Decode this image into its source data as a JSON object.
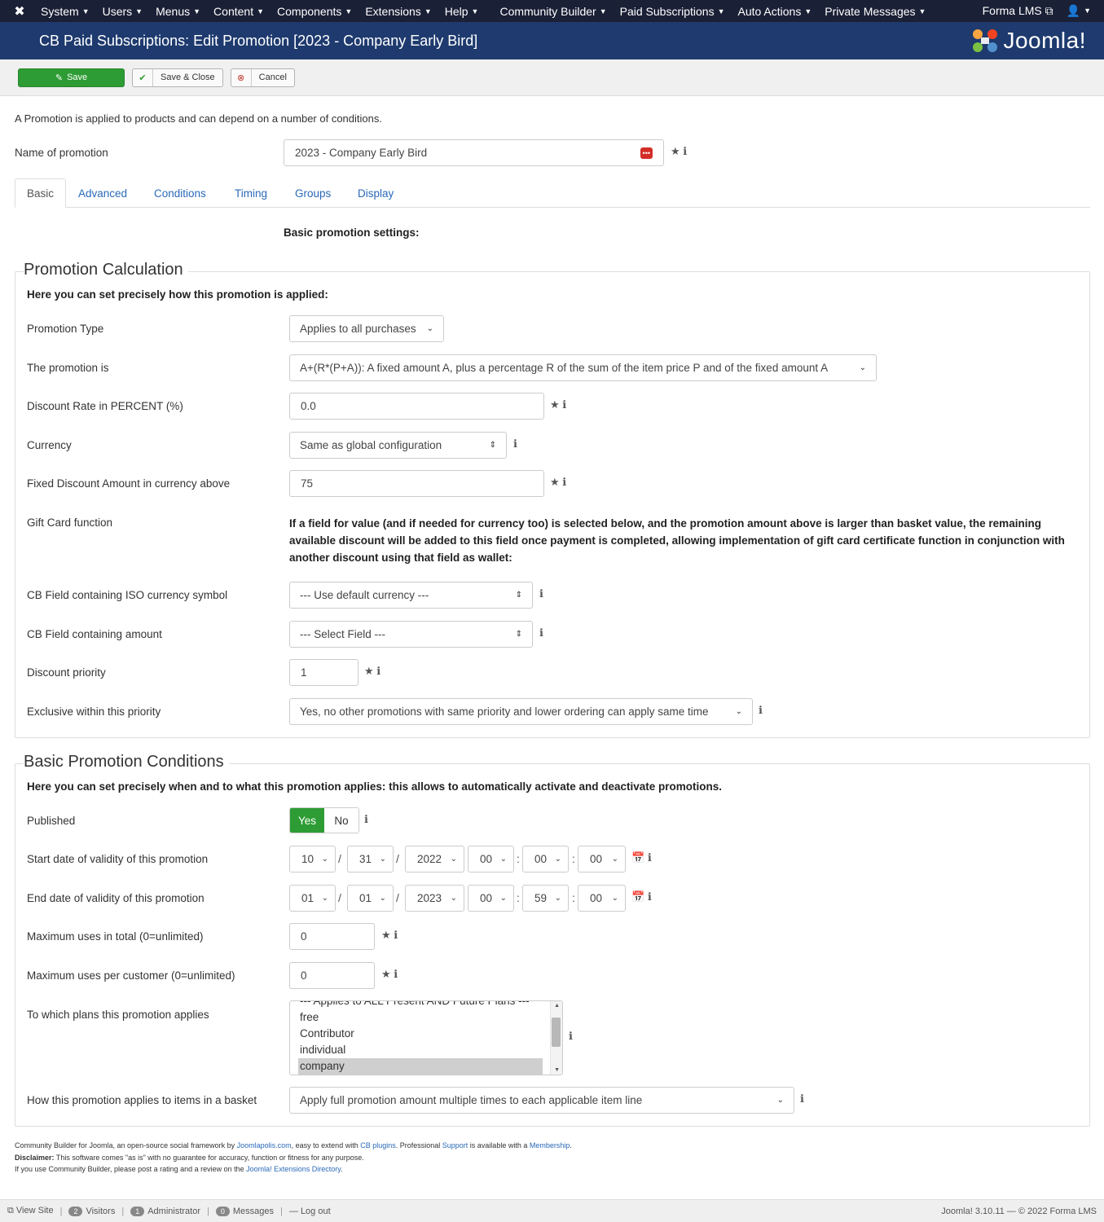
{
  "topnav": {
    "menu": [
      "System",
      "Users",
      "Menus",
      "Content",
      "Components",
      "Extensions",
      "Help",
      "Community Builder",
      "Paid Subscriptions",
      "Auto Actions",
      "Private Messages"
    ],
    "site_link": "Forma LMS"
  },
  "titlebar": {
    "title": "CB Paid Subscriptions: Edit Promotion [2023 - Company Early Bird]",
    "brand": "Joomla!"
  },
  "toolbar": {
    "save": "Save",
    "save_close": "Save & Close",
    "cancel": "Cancel"
  },
  "intro": "A Promotion is applied to products and can depend on a number of conditions.",
  "name": {
    "label": "Name of promotion",
    "value": "2023 - Company Early Bird"
  },
  "tabs": [
    "Basic",
    "Advanced",
    "Conditions",
    "Timing",
    "Groups",
    "Display"
  ],
  "basic_heading": "Basic promotion settings:",
  "calc": {
    "legend": "Promotion Calculation",
    "desc_pre": "Here you can set precisely ",
    "desc_bold": "how",
    "desc_post": " this promotion is applied:",
    "type_label": "Promotion Type",
    "type_value": "Applies to all purchases",
    "is_label": "The promotion is",
    "is_value": "A+(R*(P+A)): A fixed amount A, plus a percentage R of the sum of the item price P and of the fixed amount A",
    "rate_label": "Discount Rate in PERCENT (%)",
    "rate_value": "0.0",
    "currency_label": "Currency",
    "currency_value": "Same as global configuration",
    "fixed_label": "Fixed Discount Amount in currency above",
    "fixed_value": "75",
    "gift_label": "Gift Card function",
    "gift_note": "If a field for value (and if needed for currency too) is selected below, and the promotion amount above is larger than basket value, the remaining available discount will be added to this field once payment is completed, allowing implementation of gift card certificate function in conjunction with another discount using that field as wallet:",
    "iso_label": "CB Field containing ISO currency symbol",
    "iso_value": "--- Use default currency ---",
    "amount_label": "CB Field containing amount",
    "amount_value": "--- Select Field ---",
    "priority_label": "Discount priority",
    "priority_value": "1",
    "exclusive_label": "Exclusive within this priority",
    "exclusive_value": "Yes, no other promotions with same priority and lower ordering can apply same time"
  },
  "cond": {
    "legend": "Basic Promotion Conditions",
    "desc_a": "Here you can set precisely ",
    "desc_b": "when",
    "desc_c": " and ",
    "desc_d": "to what",
    "desc_e": " this promotion applies: this allows to automatically activate and deactivate promotions.",
    "published_label": "Published",
    "yes": "Yes",
    "no": "No",
    "start_label": "Start date of validity of this promotion",
    "start": [
      "10",
      "31",
      "2022",
      "00",
      "00",
      "00"
    ],
    "end_label": "End date of validity of this promotion",
    "end": [
      "01",
      "01",
      "2023",
      "00",
      "59",
      "00"
    ],
    "max_total_label": "Maximum uses in total (0=unlimited)",
    "max_total": "0",
    "max_cust_label": "Maximum uses per customer (0=unlimited)",
    "max_cust": "0",
    "plans_label": "To which plans this promotion applies",
    "plans": [
      "--- Applies to ALL Present AND Future Plans ---",
      "free",
      "Contributor",
      "individual",
      "company"
    ],
    "basket_label": "How this promotion applies to items in a basket",
    "basket_value": "Apply full promotion amount multiple times to each applicable item line"
  },
  "footer": {
    "l1a": "Community Builder for Joomla, an open-source social framework by ",
    "l1b": "Joomlapolis.com",
    "l1c": ", easy to extend with ",
    "l1d": "CB plugins",
    "l1e": ". Professional ",
    "l1f": "Support",
    "l1g": " is available with a ",
    "l1h": "Membership",
    "l1i": ".",
    "l2a": "Disclaimer:",
    "l2b": " This software comes \"as is\" with no guarantee for accuracy, function or fitness for any purpose.",
    "l3a": "If you use Community Builder, please post a rating and a review on the ",
    "l3b": "Joomla! Extensions Directory",
    "l3c": "."
  },
  "status": {
    "view_site": "View Site",
    "visitors_count": "2",
    "visitors": "Visitors",
    "admin_count": "1",
    "admin": "Administrator",
    "messages_count": "0",
    "messages": "Messages",
    "logout": "Log out",
    "version": "Joomla! 3.10.11 — © 2022 Forma LMS"
  }
}
